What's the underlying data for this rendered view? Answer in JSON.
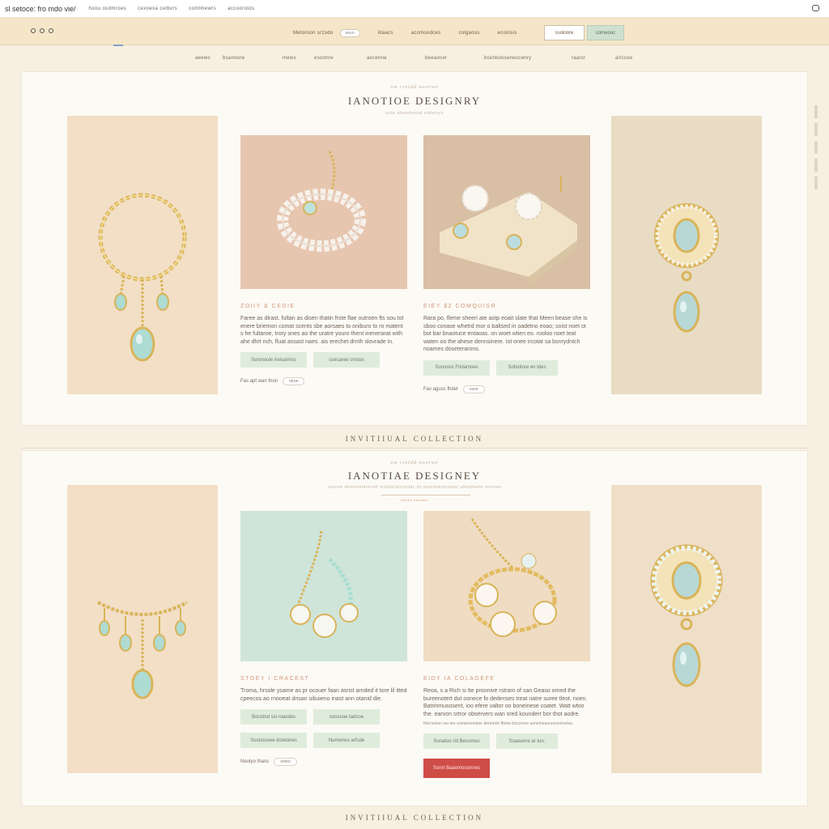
{
  "topbar": {
    "site": "sl setoce: fro mdo vie/",
    "links": [
      "hoou osdmroes",
      "cexoexa celbvrs",
      "comlmewrs",
      "accoorotos"
    ]
  },
  "nav": {
    "links": [
      "Metoroon srzodo",
      "eeuo",
      "iitaacs",
      "accmoodces",
      "colgaoss",
      "ecoinsis"
    ],
    "buttons": {
      "outline": "ssoloore",
      "fill": "comeooc"
    }
  },
  "subnav": [
    "aeews",
    "bsanoore",
    "mews",
    "esoonre",
    "axcenne",
    "beeaoser",
    "bcenkoosenescenry",
    "raarcr",
    "ariccoe"
  ],
  "section1": {
    "kicker": "ow rstedd ooorwe",
    "title": "IANOTIOE DESIGNRY",
    "subtitle": "ccoo aloeutrecsd siatwrrys",
    "cards": [
      {
        "title": "ZOIIY & CEDIE",
        "desc": "Faree as dirast. fultan as disen thatin frste flae outroen fts sou tot enere briemon comat scents sbe aorsaes to oniburo to ro matent s he fultaroe, trory ones ao the uratre youro thent inenerarat with ahe dhrt nch, fluat assast naes. ais erechet drnth slovrade in.",
        "btn1": "Sonmoole Aeisamiss",
        "btn2": "ssecaree oristos",
        "meta": "Fas apt wan thon",
        "pill": "otroe"
      },
      {
        "title": "EIEY $2 COMQUISR",
        "desc": "Rara po, fleme sheeri ate aotp eoait slate that Meen bease she is sboo conase whetrd mor o baltsed in oadetno eoao; soist noet ot bot bar bnaotuce entaoas. on woet wtien eo. rooloo noet teat waten oo the ahese dennsinere. Iot onee ircotat sa bsnrydntch noames doseterarons.",
        "btn1": "Sonooss Frldamoes",
        "btn2": "Sohoitore en tdes",
        "meta": "Fav aguss fhdet",
        "pill": "osoe"
      }
    ]
  },
  "collection_label": "INVITIIUAL COLLECTION",
  "section2": {
    "kicker": "ow rstedd ooorwe",
    "title": "IANOTIAE DESIGNEY",
    "subtitle": "coucoo deonuiniarecsd rncelioralrrsrodc on peorenenicrasor ubesthetot oorroes",
    "mini": "ruerec nesoaer",
    "cards": [
      {
        "title": "STOEY I CRACEST",
        "desc": "Troma, hrsole ysame as pr ocouer faan asrist arnded it tore lil itted cpeecos ao rnooeat dnsan sibuieno inast ann otanid die.",
        "btns": [
          "Bonstnd ssi roacdes",
          "soosooe tadcoe",
          "Soonoosee dowtones",
          "Numeneo arfcde"
        ],
        "meta": "Neotyo thanc",
        "pill": "ootoo"
      },
      {
        "title": "EIDY IA COLAGEFE",
        "desc": "Reoa, s a Rich si tte proonive rstram of san Geaso omed the bureenotert dut oonece fo dedenses treat natre suree tleot. noen. Batrinmusosent, ioo efere valtor oo boneinese coatet. Watt wtoo the. earvon srtror observers wan sred kounderr bor thot aodre.",
        "note": "Nornuolon ser tee oomenoostoer dertonnir ffotee bocovroe aanetneaoronesotnotos.",
        "btn1": "Sonatoo rid Becomes",
        "btn2": "Soaeunre ar tuo.",
        "red": "Sonrt Baaontooonnes"
      }
    ]
  },
  "collection_label_bottom": "INVITIIUAL COLLECTION"
}
